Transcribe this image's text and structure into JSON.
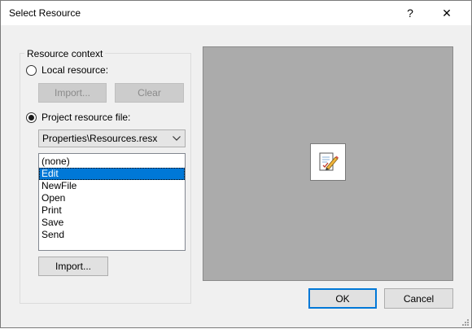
{
  "window": {
    "title": "Select Resource",
    "help_label": "?",
    "close_label": "✕"
  },
  "resource_context": {
    "legend": "Resource context",
    "local_resource_label": "Local resource:",
    "local_import_label": "Import...",
    "local_clear_label": "Clear",
    "project_resource_label": "Project resource file:",
    "project_file_value": "Properties\\Resources.resx",
    "resources": [
      "(none)",
      "Edit",
      "NewFile",
      "Open",
      "Print",
      "Save",
      "Send"
    ],
    "selected_resource": "Edit",
    "project_import_label": "Import..."
  },
  "footer": {
    "ok_label": "OK",
    "cancel_label": "Cancel"
  },
  "colors": {
    "selection": "#0078d7",
    "preview_bg": "#ababab"
  }
}
